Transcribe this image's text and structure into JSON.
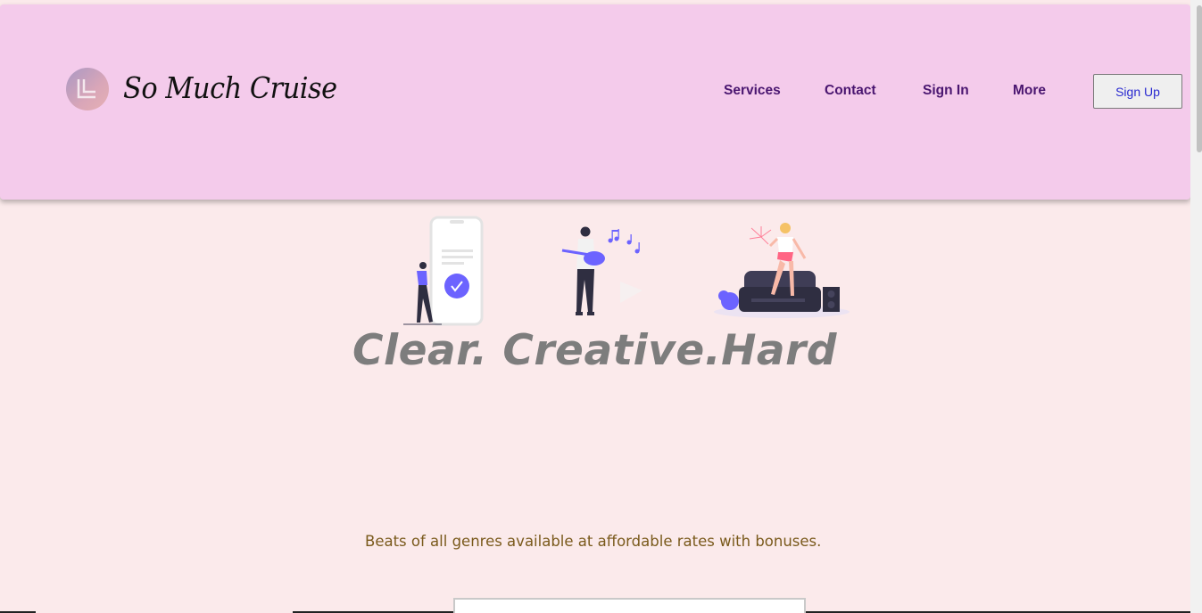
{
  "header": {
    "brand_name": "So Much Cruise",
    "nav": [
      {
        "label": "Services"
      },
      {
        "label": "Contact"
      },
      {
        "label": "Sign In"
      },
      {
        "label": "More"
      }
    ],
    "signup_label": "Sign Up"
  },
  "hero": {
    "title": "Clear. Creative.Hard",
    "subtitle": "Beats of all genres available at affordable rates with bonuses."
  },
  "colors": {
    "header_bg": "#f4cbeb",
    "page_bg": "#fbeaeb",
    "nav_text": "#4a1670",
    "accent": "#6c63ff",
    "title_text": "#7d7d7d",
    "subtitle_text": "#7a5a1c"
  },
  "icons": [
    "logo-mark-icon",
    "checkmark-icon",
    "music-notes-icon"
  ]
}
